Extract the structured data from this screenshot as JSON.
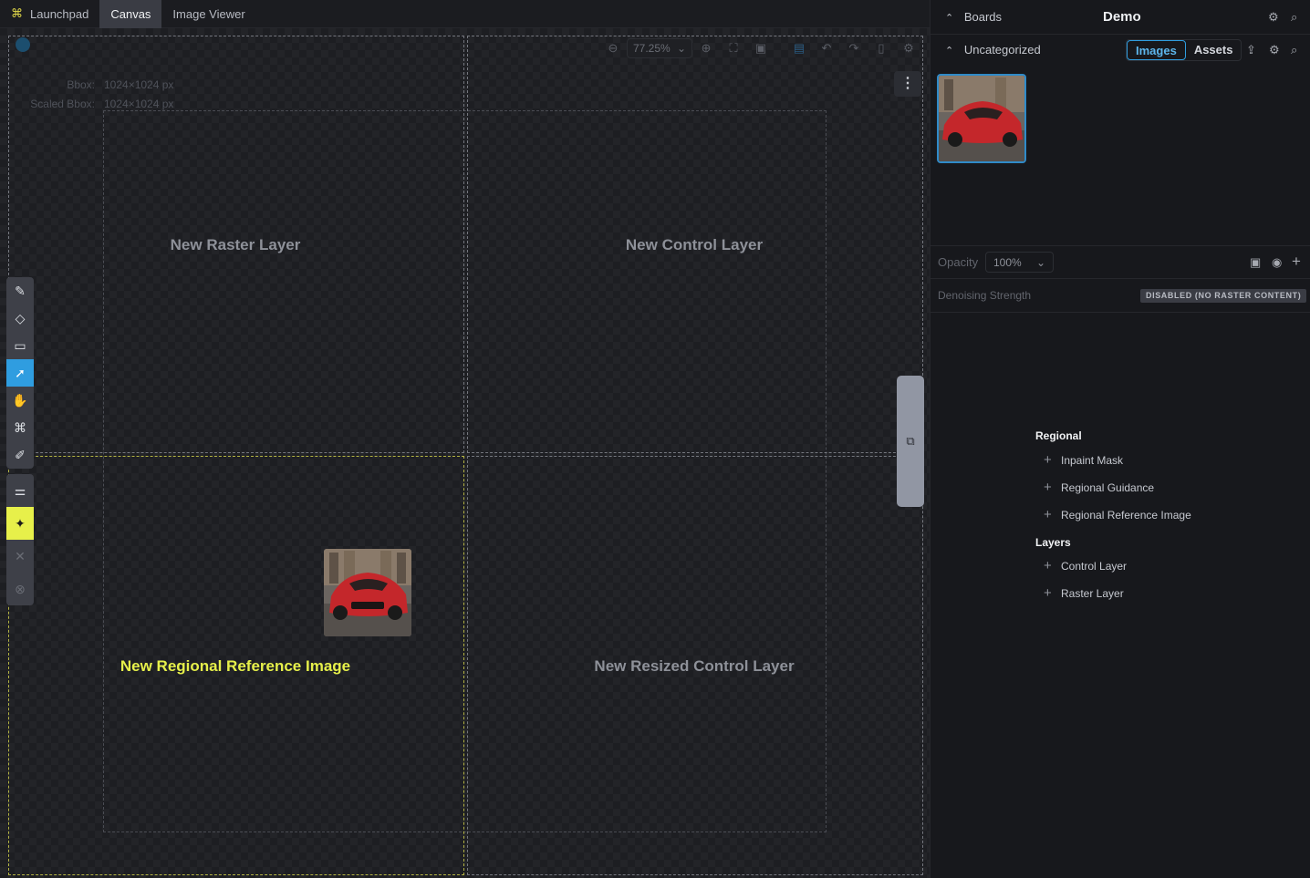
{
  "tabs": {
    "launchpad": "Launchpad",
    "canvas": "Canvas",
    "image_viewer": "Image Viewer"
  },
  "canvas": {
    "zoom": "77.25%",
    "bbox_label": "Bbox:",
    "bbox_value": "1024×1024 px",
    "scaled_bbox_label": "Scaled Bbox:",
    "scaled_bbox_value": "1024×1024 px",
    "drop_zones": {
      "raster": "New Raster Layer",
      "control": "New Control Layer",
      "regional_ref": "New Regional Reference Image",
      "resized_control": "New Resized Control Layer"
    }
  },
  "toolbar": {
    "tools": [
      "brush-icon",
      "eraser-icon",
      "rect-icon",
      "move-icon",
      "hand-icon",
      "transform-icon",
      "colorpicker-icon"
    ],
    "active_tool": "move-icon"
  },
  "right_panel": {
    "boards_label": "Boards",
    "board_name": "Demo",
    "uncategorized_label": "Uncategorized",
    "images_tab": "Images",
    "assets_tab": "Assets",
    "opacity_label": "Opacity",
    "opacity_value": "100%",
    "denoising_label": "Denoising Strength",
    "denoising_badge": "DISABLED (NO RASTER CONTENT)",
    "regional_heading": "Regional",
    "regional_items": [
      "Inpaint Mask",
      "Regional Guidance",
      "Regional Reference Image"
    ],
    "layers_heading": "Layers",
    "layers_items": [
      "Control Layer",
      "Raster Layer"
    ]
  },
  "colors": {
    "accent_blue": "#2f9de0",
    "highlight_yellow": "#e6f04a"
  }
}
